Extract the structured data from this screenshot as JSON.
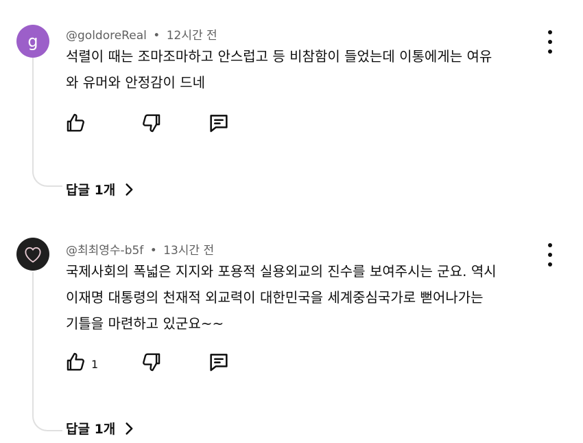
{
  "comments": [
    {
      "avatar_letter": "g",
      "author": "@goldoreReal",
      "dot": "•",
      "time": "12시간 전",
      "text": "석렬이 때는 조마조마하고 안스럽고 등 비참함이 들었는데 이통에게는 여유\n와 유머와  안정감이 드네",
      "like_count": "",
      "replies": "답글 1개"
    },
    {
      "avatar_icon": "heart-icon",
      "author": "@최최영수-b5f",
      "dot": "•",
      "time": "13시간 전",
      "text": "국제사회의 폭넓은 지지와 포용적 실용외교의 진수를 보여주시는 군요. 역시\n이재명 대통령의 천재적 외교력이 대한민국을 세계중심국가로 뻗어나가는\n기틀을 마련하고 있군요~~",
      "like_count": "1",
      "replies": "답글 1개"
    }
  ],
  "colors": {
    "avatar_purple": "#9c5fc9",
    "avatar_dark": "#1f1f1f",
    "meta_gray": "#606060",
    "thread_line": "#e0e0e0"
  }
}
